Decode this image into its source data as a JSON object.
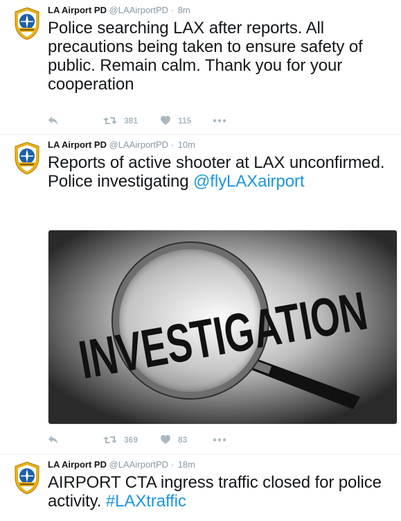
{
  "tweets": [
    {
      "name": "LA Airport PD",
      "handle": "@LAAirportPD",
      "dot": "·",
      "time": "8m",
      "text": "Police searching LAX after reports. All precautions being taken to ensure safety of public. Remain calm. Thank you for your cooperation",
      "retweets": "381",
      "likes": "115"
    },
    {
      "name": "LA Airport PD",
      "handle": "@LAAirportPD",
      "dot": "·",
      "time": "10m",
      "text": "Reports of active shooter at LAX unconfirmed. Police investigating",
      "mention": "@flyLAXairport",
      "image_word": "INVESTIGATION",
      "retweets": "369",
      "likes": "83"
    },
    {
      "name": "LA Airport PD",
      "handle": "@LAAirportPD",
      "dot": "·",
      "time": "18m",
      "text": "AIRPORT CTA ingress traffic closed for police activity.",
      "hashtag": "#LAXtraffic"
    }
  ],
  "icons": {
    "reply": "reply-icon",
    "retweet": "retweet-icon",
    "like": "heart-icon",
    "more": "more-icon",
    "avatar": "police-badge-avatar"
  },
  "colors": {
    "link": "#1b95e0",
    "muted": "#8899a6",
    "action": "#aab8c2",
    "badge_gold": "#e8b21c",
    "badge_blue": "#1e5fa8"
  }
}
